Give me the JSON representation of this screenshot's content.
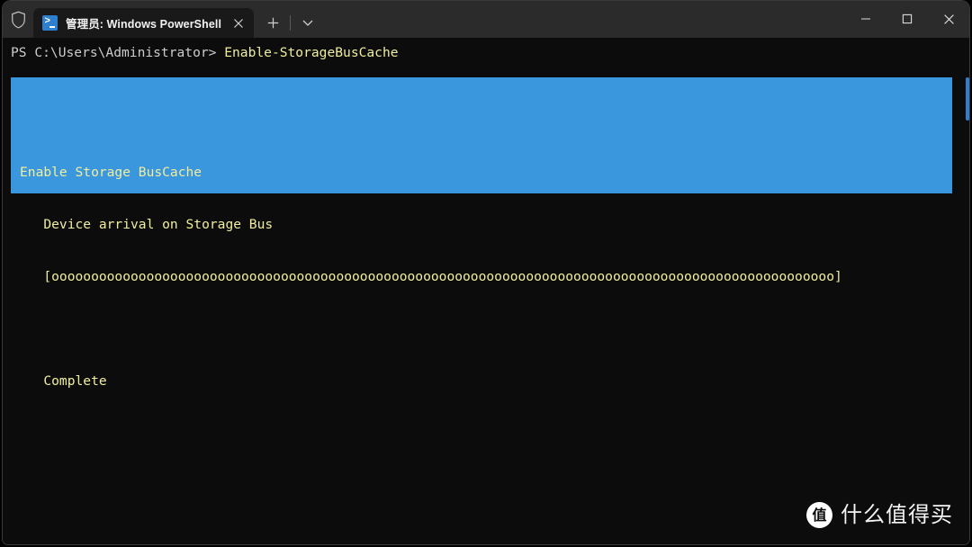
{
  "window": {
    "shield_icon": "shield-icon",
    "background_color": "#0c0c0c",
    "titlebar_color": "#2b2b2b"
  },
  "titlebar": {
    "tabs": [
      {
        "icon": "powershell-icon",
        "title": "管理员: Windows PowerShell",
        "close_label": "✕",
        "active": true
      }
    ],
    "new_tab_label": "+",
    "dropdown_label": "⌄",
    "caption": {
      "minimize_label": "—",
      "maximize_label": "☐",
      "close_label": "✕"
    }
  },
  "terminal": {
    "prompt_path": "PS C:\\Users\\Administrator> ",
    "command": "Enable-StorageBusCache",
    "prompt_color": "#cccccc",
    "command_color": "#f0ee9e",
    "progress": {
      "background_color": "#3a96dd",
      "text_color": "#f0ee9e",
      "title": "Enable Storage BusCache",
      "activity": "   Device arrival on Storage Bus",
      "bar": "   [ooooooooooooooooooooooooooooooooooooooooooooooooooooooooooooooooooooooooooooooooooooooooooooooooooo]",
      "blank": "",
      "status": "   Complete"
    }
  },
  "watermark": {
    "logo_char": "值",
    "text": "什么值得买"
  }
}
